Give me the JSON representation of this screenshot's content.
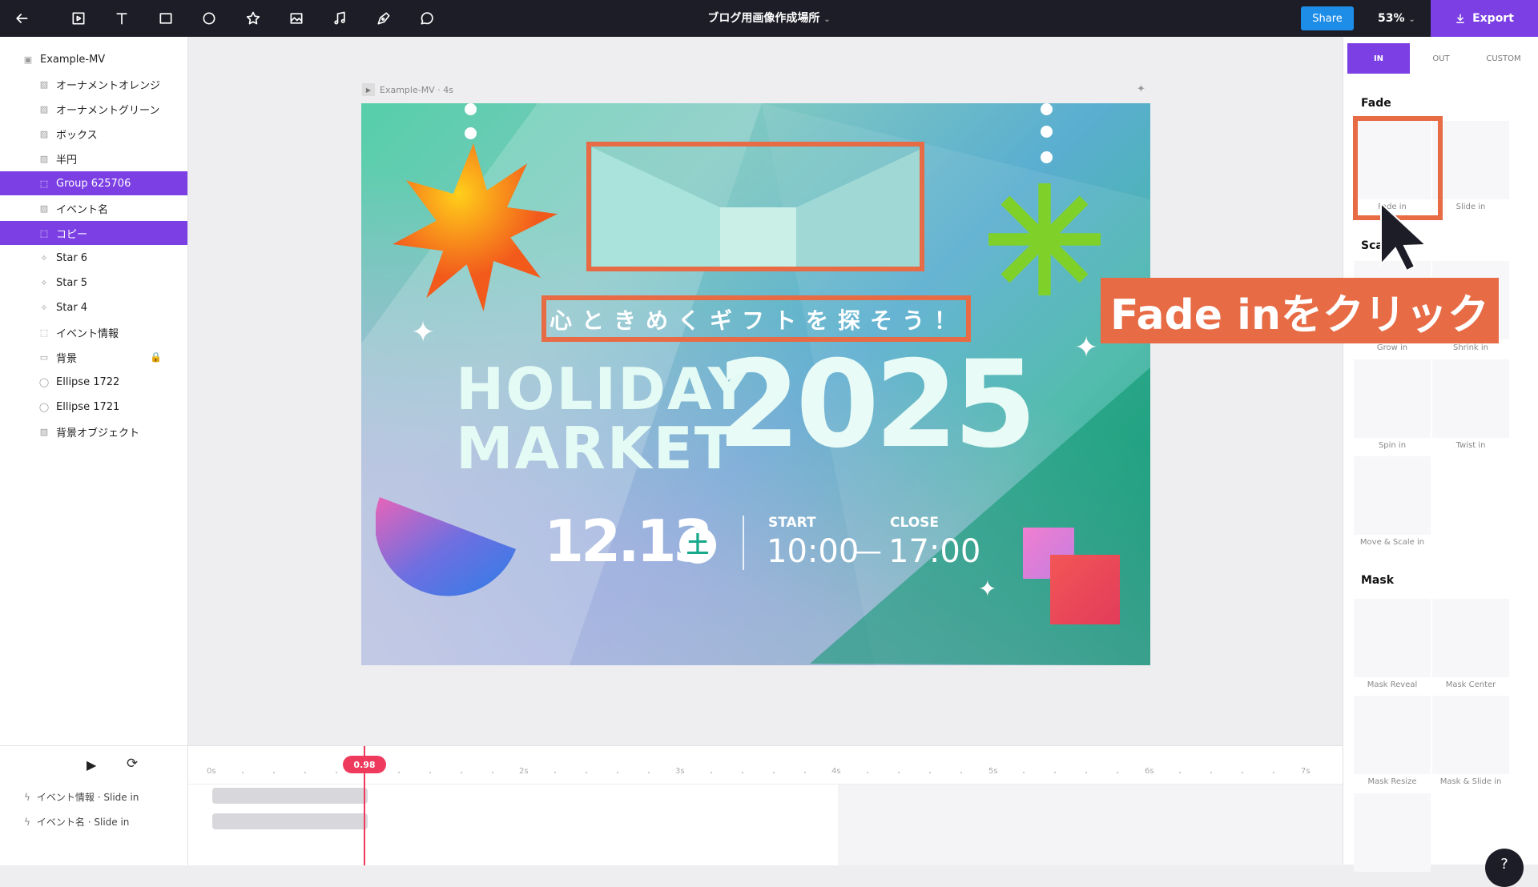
{
  "toolbar": {
    "doc_title": "ブログ用画像作成場所",
    "share_label": "Share",
    "zoom": "53%",
    "export_label": "Export"
  },
  "layers": [
    {
      "label": "Example-MV",
      "icon": "frame-icon",
      "indent": 0,
      "selected": false
    },
    {
      "label": "オーナメントオレンジ",
      "icon": "image-icon",
      "indent": 1,
      "selected": false
    },
    {
      "label": "オーナメントグリーン",
      "icon": "image-icon",
      "indent": 1,
      "selected": false
    },
    {
      "label": "ボックス",
      "icon": "image-icon",
      "indent": 1,
      "selected": false
    },
    {
      "label": "半円",
      "icon": "image-icon",
      "indent": 1,
      "selected": false
    },
    {
      "label": "Group 625706",
      "icon": "group-icon",
      "indent": 1,
      "selected": true
    },
    {
      "label": "イベント名",
      "icon": "image-icon",
      "indent": 1,
      "selected": false
    },
    {
      "label": "コピー",
      "icon": "group-icon",
      "indent": 1,
      "selected": true
    },
    {
      "label": "Star 6",
      "icon": "star-icon",
      "indent": 1,
      "selected": false
    },
    {
      "label": "Star 5",
      "icon": "star-icon",
      "indent": 1,
      "selected": false
    },
    {
      "label": "Star 4",
      "icon": "star-icon",
      "indent": 1,
      "selected": false
    },
    {
      "label": "イベント情報",
      "icon": "group-icon",
      "indent": 1,
      "selected": false
    },
    {
      "label": "背景",
      "icon": "rect-icon",
      "indent": 1,
      "selected": false,
      "locked": true
    },
    {
      "label": "Ellipse 1722",
      "icon": "ellipse-icon",
      "indent": 1,
      "selected": false
    },
    {
      "label": "Ellipse 1721",
      "icon": "ellipse-icon",
      "indent": 1,
      "selected": false
    },
    {
      "label": "背景オブジェクト",
      "icon": "image-icon",
      "indent": 1,
      "selected": false
    }
  ],
  "canvas": {
    "frame_label": "Example-MV · 4s",
    "artboard": {
      "tagline": "心ときめくギフトを探そう！",
      "title_line1": "HOLIDAY",
      "title_line2": "MARKET",
      "year": "2025",
      "date": "12.13",
      "weekday": "土",
      "start_label": "START",
      "close_label": "CLOSE",
      "start_time": "10:00",
      "dash": "—",
      "close_time": "17:00"
    }
  },
  "callout": "Fade inをクリック",
  "panel": {
    "tabs": [
      "IN",
      "OUT",
      "CUSTOM"
    ],
    "sections": [
      {
        "title": "Fade",
        "items": [
          "Fade in",
          "Slide in"
        ]
      },
      {
        "title": "Sca",
        "items": [
          "Grow in",
          "Shrink in",
          "Spin in",
          "Twist in",
          "Move & Scale in"
        ]
      },
      {
        "title": "Mask",
        "items": [
          "Mask Reveal",
          "Mask Center",
          "Mask Resize",
          "Mask & Slide in"
        ]
      }
    ]
  },
  "timeline": {
    "playhead": "0.98",
    "ticks": [
      "0s",
      "2s",
      "3s",
      "4s",
      "5s",
      "6s",
      "7s"
    ],
    "tracks": [
      "イベント情報 · Slide in",
      "イベント名 · Slide in"
    ]
  },
  "help_label": "?"
}
